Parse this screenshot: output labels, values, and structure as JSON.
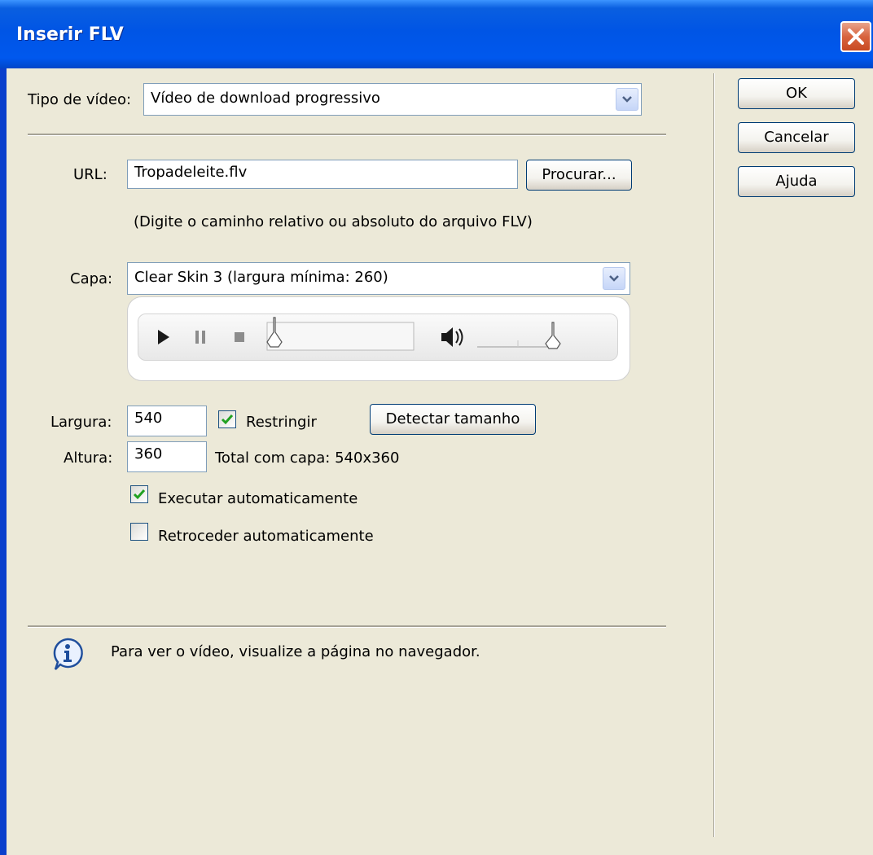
{
  "window": {
    "title": "Inserir FLV"
  },
  "video_type": {
    "label": "Tipo de vídeo:",
    "value": "Vídeo de download progressivo"
  },
  "url": {
    "label": "URL:",
    "value": "Tropadeleite.flv",
    "browse_button": "Procurar...",
    "hint": "(Digite o caminho relativo ou absoluto do arquivo FLV)"
  },
  "skin": {
    "label": "Capa:",
    "value": "Clear Skin 3 (largura mínima: 260)"
  },
  "width": {
    "label": "Largura:",
    "value": "540"
  },
  "constrain": {
    "label": "Restringir",
    "checked": true
  },
  "detect_button": "Detectar tamanho",
  "height": {
    "label": "Altura:",
    "value": "360"
  },
  "total_with_skin": "Total com capa: 540x360",
  "autoplay": {
    "label": "Executar automaticamente",
    "checked": true
  },
  "autorewind": {
    "label": "Retroceder automaticamente",
    "checked": false
  },
  "buttons": {
    "ok": "OK",
    "cancel": "Cancelar",
    "help": "Ajuda"
  },
  "info_message": "Para ver o vídeo, visualize a página no navegador.",
  "colors": {
    "titlebar": "#0055E5",
    "dialog_bg": "#ECE9D8",
    "close_button": "#D8643E",
    "check_mark": "#21A121"
  },
  "icons": [
    "close-icon",
    "dropdown-arrow-icon",
    "play-icon",
    "pause-icon",
    "stop-icon",
    "volume-icon",
    "checkmark-icon",
    "info-icon"
  ]
}
